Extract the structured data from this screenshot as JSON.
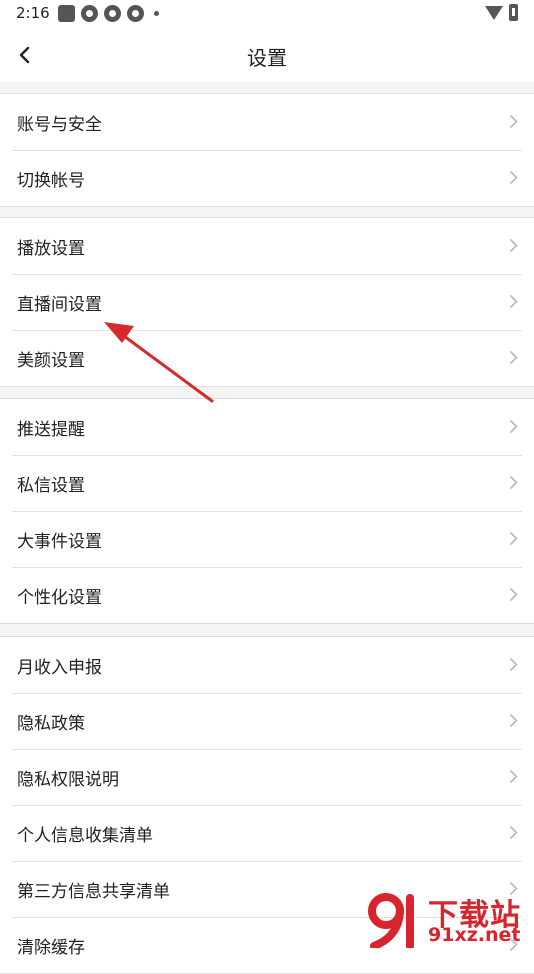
{
  "status_bar": {
    "time": "2:16"
  },
  "header": {
    "title": "设置"
  },
  "groups": [
    {
      "items": [
        {
          "label": "账号与安全"
        },
        {
          "label": "切换帐号"
        }
      ]
    },
    {
      "items": [
        {
          "label": "播放设置"
        },
        {
          "label": "直播间设置"
        },
        {
          "label": "美颜设置"
        }
      ]
    },
    {
      "items": [
        {
          "label": "推送提醒"
        },
        {
          "label": "私信设置"
        },
        {
          "label": "大事件设置"
        },
        {
          "label": "个性化设置"
        }
      ]
    },
    {
      "items": [
        {
          "label": "月收入申报"
        },
        {
          "label": "隐私政策"
        },
        {
          "label": "隐私权限说明"
        },
        {
          "label": "个人信息收集清单"
        },
        {
          "label": "第三方信息共享清单"
        },
        {
          "label": "清除缓存"
        }
      ]
    }
  ],
  "watermark": {
    "title": "下载站",
    "url": "91xz.net"
  },
  "colors": {
    "accent": "#d8242d",
    "arrow": "#d42a2a"
  }
}
